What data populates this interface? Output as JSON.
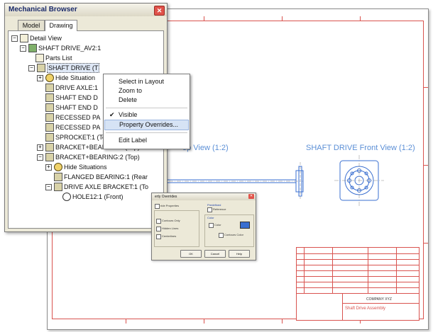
{
  "browser": {
    "title": "Mechanical Browser",
    "tabs": [
      {
        "label": "Model"
      },
      {
        "label": "Drawing"
      }
    ],
    "tree": [
      {
        "label": "Detail View"
      },
      {
        "label": "SHAFT DRIVE_AV2:1"
      },
      {
        "label": "Parts List"
      },
      {
        "label": "SHAFT DRIVE (T"
      },
      {
        "label": "Hide Situation"
      },
      {
        "label": "DRIVE AXLE:1"
      },
      {
        "label": "SHAFT END D"
      },
      {
        "label": "SHAFT END D"
      },
      {
        "label": "RECESSED PA"
      },
      {
        "label": "RECESSED PA"
      },
      {
        "label": "SPROCKET:1 (Top)"
      },
      {
        "label": "BRACKET+BEARING:1 (Top)"
      },
      {
        "label": "BRACKET+BEARING:2 (Top)"
      },
      {
        "label": "Hide Situations"
      },
      {
        "label": "FLANGED BEARING:1 (Rear"
      },
      {
        "label": "DRIVE AXLE BRACKET:1 (To"
      },
      {
        "label": "HOLE12:1 (Front)"
      }
    ]
  },
  "context_menu": {
    "items": [
      {
        "label": "Select in Layout"
      },
      {
        "label": "Zoom to"
      },
      {
        "label": "Delete"
      },
      {
        "label": "Visible",
        "checked": true
      },
      {
        "label": "Property Overrides..."
      },
      {
        "label": "Edit Label"
      }
    ]
  },
  "drawing": {
    "top_view_label": "op View (1:2)",
    "front_view_label": "SHAFT DRIVE Front View (1:2)",
    "title_block": {
      "company": "COMPANY XYZ",
      "drawing_title": "Shaft Drive Assembly"
    }
  },
  "dialog": {
    "title": "erty Overrides",
    "override_properties": "ride Properties",
    "contours_only": "Contours Only",
    "hidden_lines": "Hidden Lines",
    "centerlines": "Centerlines",
    "predefined": "Predefined",
    "reference": "Reference",
    "color": "Color",
    "color_value": "Color",
    "contours_color": "Contours Color",
    "ok": "OK",
    "cancel": "Cancel",
    "help": "Help"
  },
  "colors": {
    "border_red": "#d9534f",
    "view_label_blue": "#5b8fd6",
    "cad_blue": "#3a6fd0"
  }
}
